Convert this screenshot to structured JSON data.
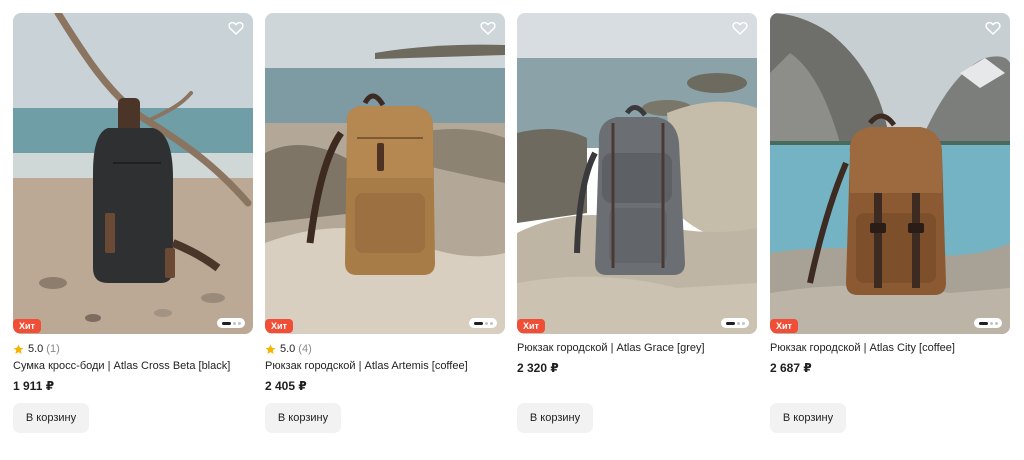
{
  "colors": {
    "badge": "#f04e36",
    "star": "#f5b400",
    "button_bg": "#f2f2f2",
    "text": "#1f1f1f",
    "muted": "#8a8a8a"
  },
  "icons": {
    "favorite": "heart-outline-icon",
    "rating": "star-icon"
  },
  "products": [
    {
      "badge": "Хит",
      "rating": "5.0",
      "reviews": "(1)",
      "title": "Сумка кросс-боди | Atlas Cross Beta [black]",
      "price": "1 911 ₽",
      "button": "В корзину",
      "image": "black sling bag on beach"
    },
    {
      "badge": "Хит",
      "rating": "5.0",
      "reviews": "(4)",
      "title": "Рюкзак городской | Atlas Artemis [coffee]",
      "price": "2 405 ₽",
      "button": "В корзину",
      "image": "brown canvas backpack on rocks"
    },
    {
      "badge": "Хит",
      "title": "Рюкзак городской | Atlas Grace [grey]",
      "price": "2 320 ₽",
      "button": "В корзину",
      "image": "grey canvas backpack on rocks"
    },
    {
      "badge": "Хит",
      "title": "Рюкзак городской | Atlas City [coffee]",
      "price": "2 687 ₽",
      "button": "В корзину",
      "image": "brown canvas backpack by mountain lake"
    }
  ]
}
